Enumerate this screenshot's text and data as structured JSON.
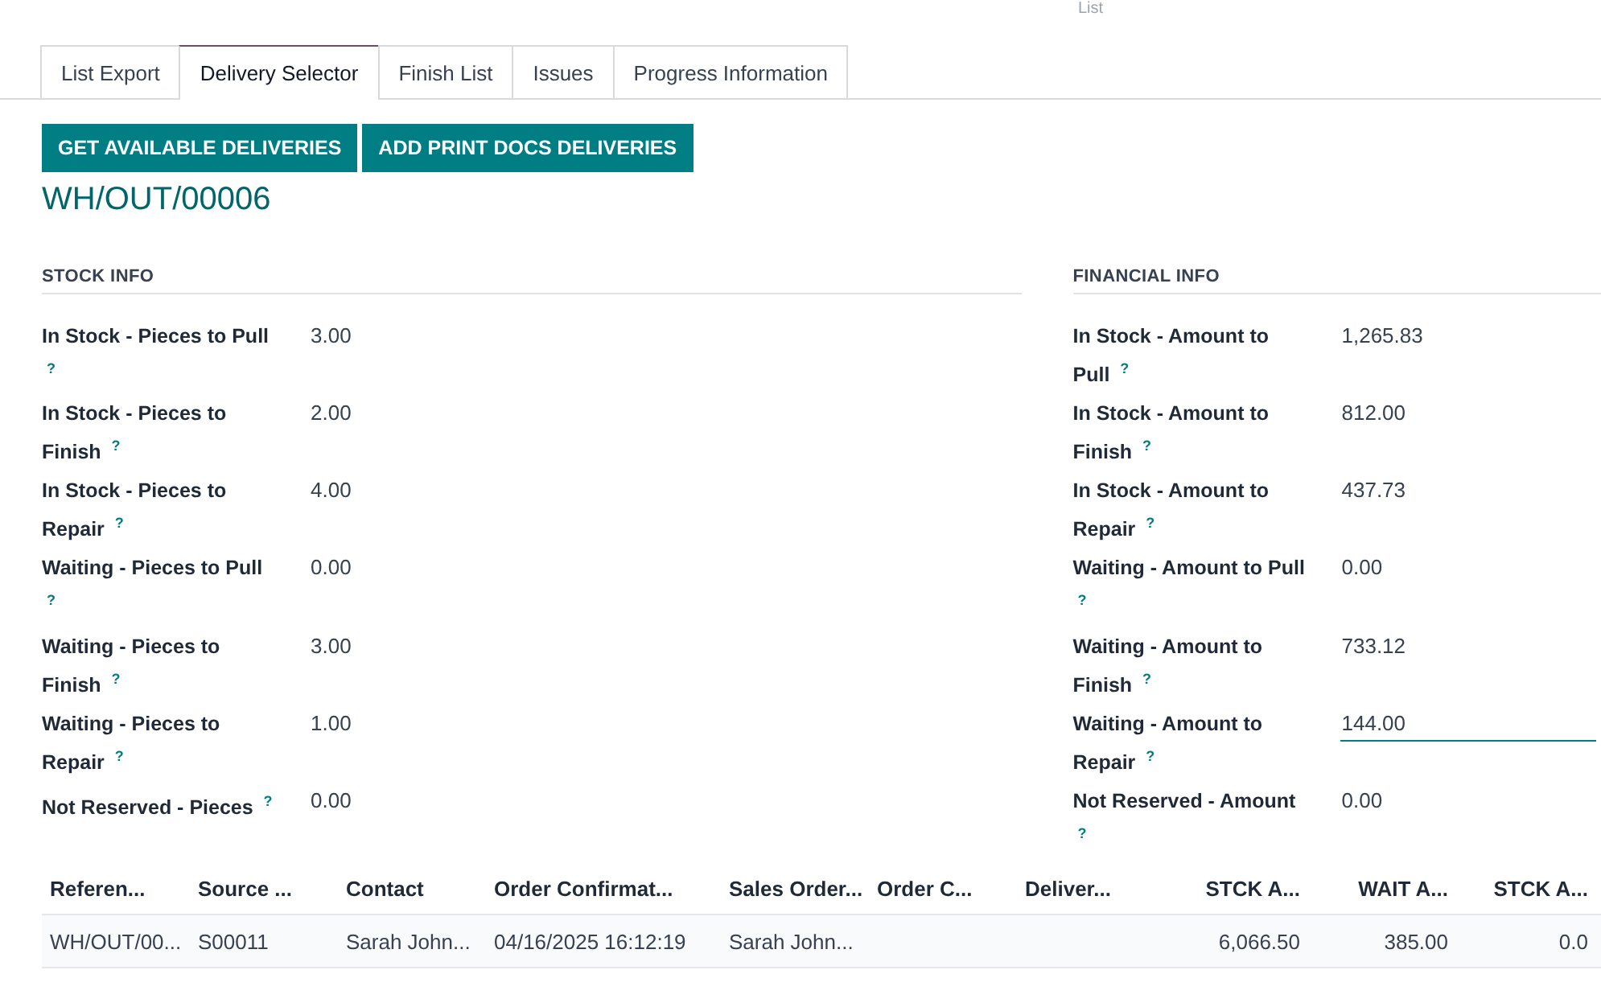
{
  "top_label": "List",
  "tabs": [
    {
      "label": "List Export",
      "selected": false
    },
    {
      "label": "Delivery Selector",
      "selected": true
    },
    {
      "label": "Finish List",
      "selected": false
    },
    {
      "label": "Issues",
      "selected": false
    },
    {
      "label": "Progress Information",
      "selected": false
    }
  ],
  "buttons": [
    "GET AVAILABLE DELIVERIES",
    "ADD PRINT DOCS DELIVERIES"
  ],
  "record_title": "WH/OUT/00006",
  "groups": [
    {
      "title": "STOCK INFO",
      "fields": [
        {
          "label": "In Stock - Pieces to Pull $^{?}$",
          "value": "3.00",
          "focused": false
        },
        {
          "label": "In Stock - Pieces to Finish $^{?}$",
          "value": "2.00",
          "focused": false
        },
        {
          "label": "In Stock - Pieces to Repair $^{?}$",
          "value": "4.00",
          "focused": false
        },
        {
          "label": "Waiting - Pieces to Pull $^{?}$",
          "value": "0.00",
          "focused": false
        },
        {
          "label": "Waiting - Pieces to Finish $^{?}$",
          "value": "3.00",
          "focused": false
        },
        {
          "label": "Waiting - Pieces to Repair $^{?}$",
          "value": "1.00",
          "focused": false
        },
        {
          "label": "Not Reserved - Pieces $^{?}$",
          "value": "0.00",
          "focused": false
        }
      ]
    },
    {
      "title": "FINANCIAL INFO",
      "fields": [
        {
          "label": "In Stock - Amount to Pull $^{?}$",
          "value": "1,265.83",
          "focused": false
        },
        {
          "label": "In Stock - Amount to Finish $^{?}$",
          "value": "812.00",
          "focused": false
        },
        {
          "label": "In Stock - Amount to Repair $^{?}$",
          "value": "437.73",
          "focused": false
        },
        {
          "label": "Waiting - Amount to Pull $^{?}$",
          "value": "0.00",
          "focused": false
        },
        {
          "label": "Waiting - Amount to Finish $^{?}$",
          "value": "733.12",
          "focused": false
        },
        {
          "label": "Waiting - Amount to Repair $^{?}$",
          "value": "144.00",
          "focused": true
        },
        {
          "label": "Not Reserved - Amount $^{?}$",
          "value": "0.00",
          "focused": false
        }
      ]
    }
  ],
  "table": {
    "columns": [
      "Referen...",
      "Source ...",
      "Contact",
      "Order Confirmat...",
      "Sales Order...",
      "Order C...",
      "Deliver...",
      "STCK A...",
      "WAIT A...",
      "STCK A..."
    ],
    "rows": [
      [
        "WH/OUT/00...",
        "S00011",
        "Sarah John...",
        "04/16/2025 16:12:19",
        "Sarah John...",
        "",
        "",
        "6,066.50",
        "385.00",
        "0.0"
      ]
    ]
  }
}
